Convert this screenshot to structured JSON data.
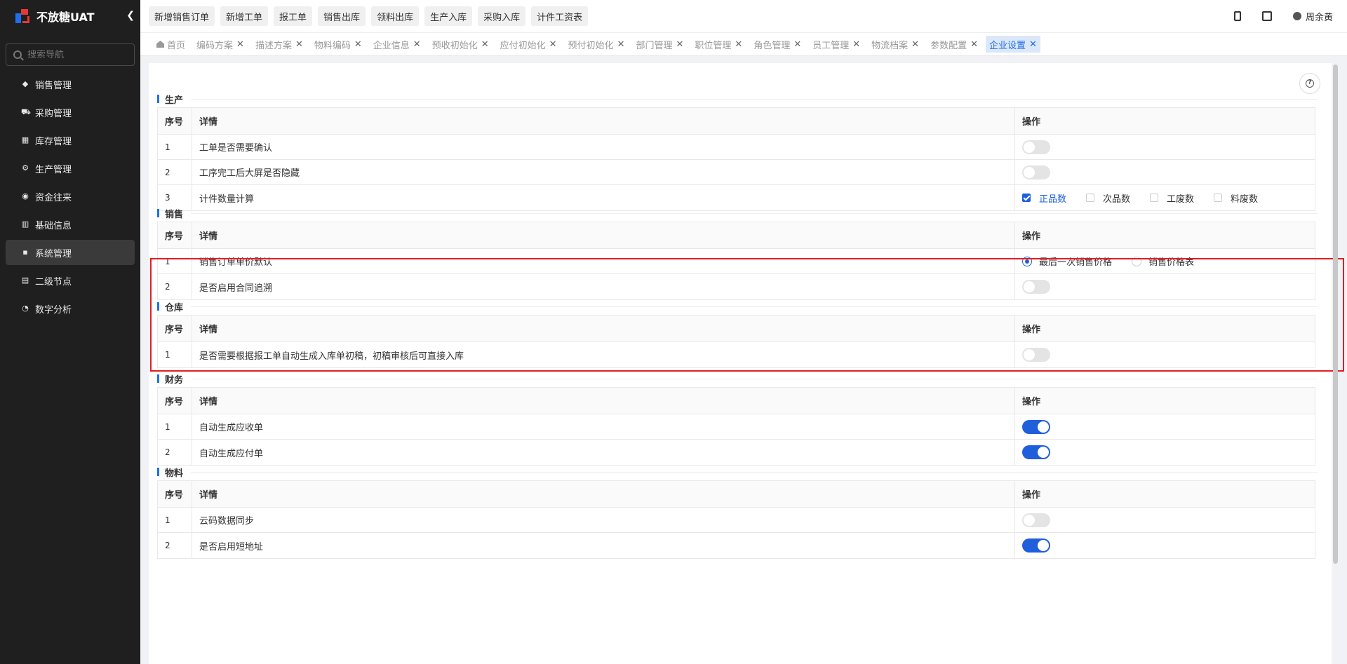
{
  "app": {
    "title": "不放糖UAT"
  },
  "search": {
    "placeholder": "搜索导航"
  },
  "sidebar": {
    "items": [
      {
        "label": "销售管理",
        "icon": "tag-icon"
      },
      {
        "label": "采购管理",
        "icon": "cart-icon"
      },
      {
        "label": "库存管理",
        "icon": "warehouse-icon"
      },
      {
        "label": "生产管理",
        "icon": "factory-icon"
      },
      {
        "label": "资金往来",
        "icon": "money-icon"
      },
      {
        "label": "基础信息",
        "icon": "info-icon"
      },
      {
        "label": "系统管理",
        "icon": "grid-icon",
        "active": true
      },
      {
        "label": "二级节点",
        "icon": "doc-icon"
      },
      {
        "label": "数字分析",
        "icon": "pie-icon"
      }
    ]
  },
  "toolbar": {
    "quick_actions": [
      "新增销售订单",
      "新增工单",
      "报工单",
      "销售出库",
      "领料出库",
      "生产入库",
      "采购入库",
      "计件工资表"
    ],
    "user_name": "周余黄"
  },
  "tabs": [
    {
      "label": "首页",
      "closable": false
    },
    {
      "label": "编码方案",
      "closable": true
    },
    {
      "label": "描述方案",
      "closable": true
    },
    {
      "label": "物料编码",
      "closable": true
    },
    {
      "label": "企业信息",
      "closable": true
    },
    {
      "label": "预收初始化",
      "closable": true
    },
    {
      "label": "应付初始化",
      "closable": true
    },
    {
      "label": "预付初始化",
      "closable": true
    },
    {
      "label": "部门管理",
      "closable": true
    },
    {
      "label": "职位管理",
      "closable": true
    },
    {
      "label": "角色管理",
      "closable": true
    },
    {
      "label": "员工管理",
      "closable": true
    },
    {
      "label": "物流档案",
      "closable": true
    },
    {
      "label": "参数配置",
      "closable": true
    },
    {
      "label": "企业设置",
      "closable": true,
      "active": true
    }
  ],
  "table_headers": {
    "index": "序号",
    "detail": "详情",
    "action": "操作"
  },
  "sections": {
    "production": {
      "title": "生产",
      "rows": [
        {
          "index": "1",
          "detail": "工单是否需要确认",
          "toggle": false
        },
        {
          "index": "2",
          "detail": "工序完工后大屏是否隐藏",
          "toggle": false
        },
        {
          "index": "3",
          "detail": "计件数量计算",
          "checkboxes": [
            {
              "label": "正品数",
              "checked": true
            },
            {
              "label": "次品数",
              "checked": false
            },
            {
              "label": "工废数",
              "checked": false
            },
            {
              "label": "料废数",
              "checked": false
            }
          ]
        }
      ]
    },
    "sales": {
      "title": "销售",
      "rows": [
        {
          "index": "1",
          "detail": "销售订单单价默认",
          "radios": [
            {
              "label": "最后一次销售价格",
              "checked": true
            },
            {
              "label": "销售价格表",
              "checked": false
            }
          ]
        },
        {
          "index": "2",
          "detail": "是否启用合同追溯",
          "toggle": false
        }
      ]
    },
    "warehouse": {
      "title": "仓库",
      "rows": [
        {
          "index": "1",
          "detail": "是否需要根据报工单自动生成入库单初稿，初稿审核后可直接入库",
          "toggle": false
        }
      ]
    },
    "finance": {
      "title": "财务",
      "rows": [
        {
          "index": "1",
          "detail": "自动生成应收单",
          "toggle": true
        },
        {
          "index": "2",
          "detail": "自动生成应付单",
          "toggle": true
        }
      ]
    },
    "material": {
      "title": "物料",
      "rows": [
        {
          "index": "1",
          "detail": "云码数据同步",
          "toggle": false
        },
        {
          "index": "2",
          "detail": "是否启用短地址",
          "toggle": true
        }
      ]
    }
  },
  "colors": {
    "accent": "#1f5fdc",
    "highlight": "#e51c23",
    "sidebar_bg": "#1f1f1f"
  }
}
